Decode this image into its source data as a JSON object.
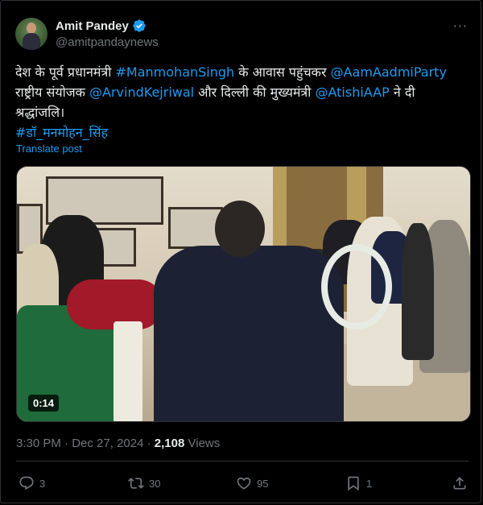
{
  "author": {
    "display_name": "Amit Pandey",
    "handle": "@amitpandaynews",
    "verified": true
  },
  "more_icon": "more-horizontal-icon",
  "post": {
    "line1_prefix": "देश के पूर्व प्रधानमंत्री ",
    "line1_mention1": "#ManmohanSingh",
    "line1_middle": " के आवास पहुंचकर ",
    "line1_mention2": "@AamAadmiParty",
    "line2_prefix": "राष्ट्रीय संयोजक ",
    "line2_mention": "@ArvindKejriwal",
    "line2_middle": " और दिल्ली की मुख्यमंत्री ",
    "line2_mention2": "@AtishiAAP",
    "line2_suffix": " ने दी",
    "line3": "श्रद्धांजलि।",
    "hashtag": "#डॉ_मनमोहन_सिंह"
  },
  "translate_label": "Translate post",
  "media": {
    "type": "video",
    "duration": "0:14"
  },
  "meta": {
    "time": "3:30 PM",
    "separator": " · ",
    "date": "Dec 27, 2024",
    "views_count": "2,108",
    "views_label": " Views"
  },
  "actions": {
    "replies": "3",
    "reposts": "30",
    "likes": "95",
    "bookmarks": "1"
  },
  "colors": {
    "accent": "#1d9bf0",
    "text": "#e7e9ea",
    "muted": "#71767b",
    "background": "#000000"
  }
}
